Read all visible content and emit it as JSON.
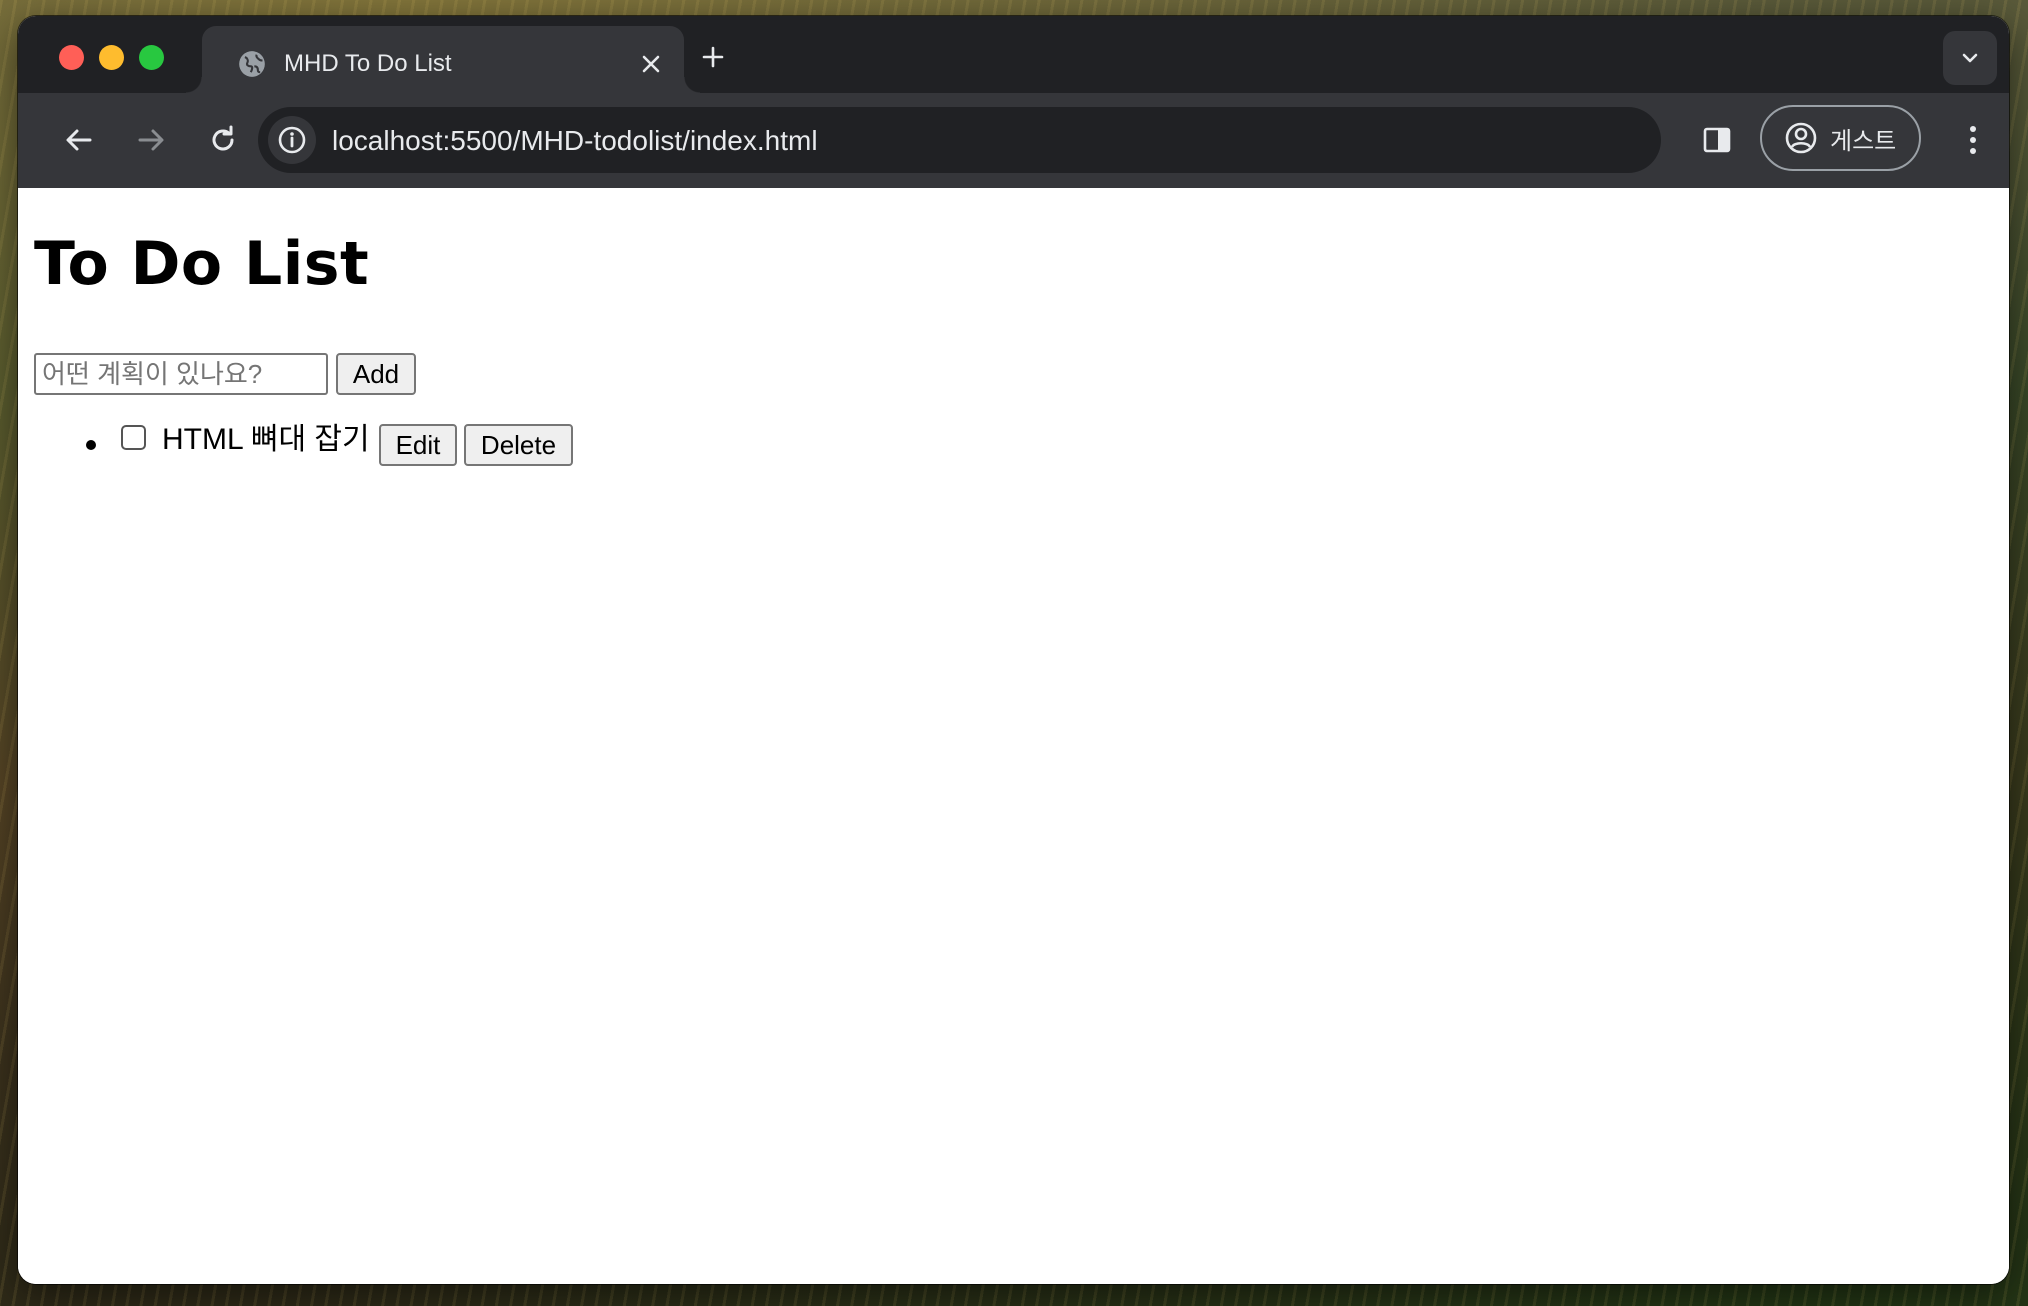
{
  "browser": {
    "tab": {
      "title": "MHD To Do List"
    },
    "url": "localhost:5500/MHD-todolist/index.html",
    "profile_label": "게스트"
  },
  "page": {
    "title": "To Do List",
    "input": {
      "value": "",
      "placeholder": "어떤 계획이 있나요?"
    },
    "add_label": "Add",
    "todos": [
      {
        "text": "HTML 뼈대 잡기",
        "checked": false,
        "edit_label": "Edit",
        "delete_label": "Delete"
      }
    ]
  },
  "icons": {
    "tab_favicon": "globe-icon",
    "tab_close": "close-icon",
    "new_tab": "plus-icon",
    "tab_search": "chevron-down-icon",
    "back": "arrow-left-icon",
    "forward": "arrow-right-icon",
    "reload": "reload-icon",
    "site_info": "info-icon",
    "side_panel": "side-panel-icon",
    "profile": "profile-icon",
    "menu": "kebab-menu-icon"
  },
  "colors": {
    "tab_strip": "#202124",
    "toolbar": "#35363a",
    "omnibox": "#202124",
    "traffic_red": "#ff5f57",
    "traffic_yellow": "#febc2e",
    "traffic_green": "#28c840"
  }
}
